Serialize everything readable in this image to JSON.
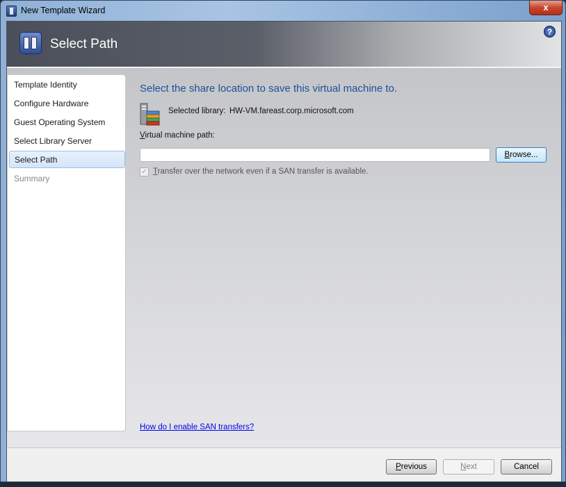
{
  "window": {
    "title": "New Template Wizard",
    "close_label": "x"
  },
  "header": {
    "title": "Select Path",
    "help_label": "?"
  },
  "sidebar": {
    "items": [
      {
        "label": "Template Identity",
        "state": "done"
      },
      {
        "label": "Configure Hardware",
        "state": "done"
      },
      {
        "label": "Guest Operating System",
        "state": "done"
      },
      {
        "label": "Select Library Server",
        "state": "done"
      },
      {
        "label": "Select Path",
        "state": "selected"
      },
      {
        "label": "Summary",
        "state": "disabled"
      }
    ]
  },
  "main": {
    "heading": "Select the share location to save this virtual machine to.",
    "library_label": "Selected library:",
    "library_value": "HW-VM.fareast.corp.microsoft.com",
    "path_label_mnemonic": "V",
    "path_label_rest": "irtual machine path:",
    "path_value": "",
    "browse_mnemonic": "B",
    "browse_rest": "rowse...",
    "transfer_checked": true,
    "transfer_mnemonic": "T",
    "transfer_rest": "ransfer over the network even if a SAN transfer is available.",
    "help_link": "How do I enable SAN transfers?"
  },
  "footer": {
    "previous_mnemonic": "P",
    "previous_rest": "revious",
    "next_mnemonic": "N",
    "next_rest": "ext",
    "cancel": "Cancel"
  },
  "colors": {
    "heading": "#1d4f9a",
    "link": "#0000ee",
    "selection": "#d4e5fa"
  }
}
